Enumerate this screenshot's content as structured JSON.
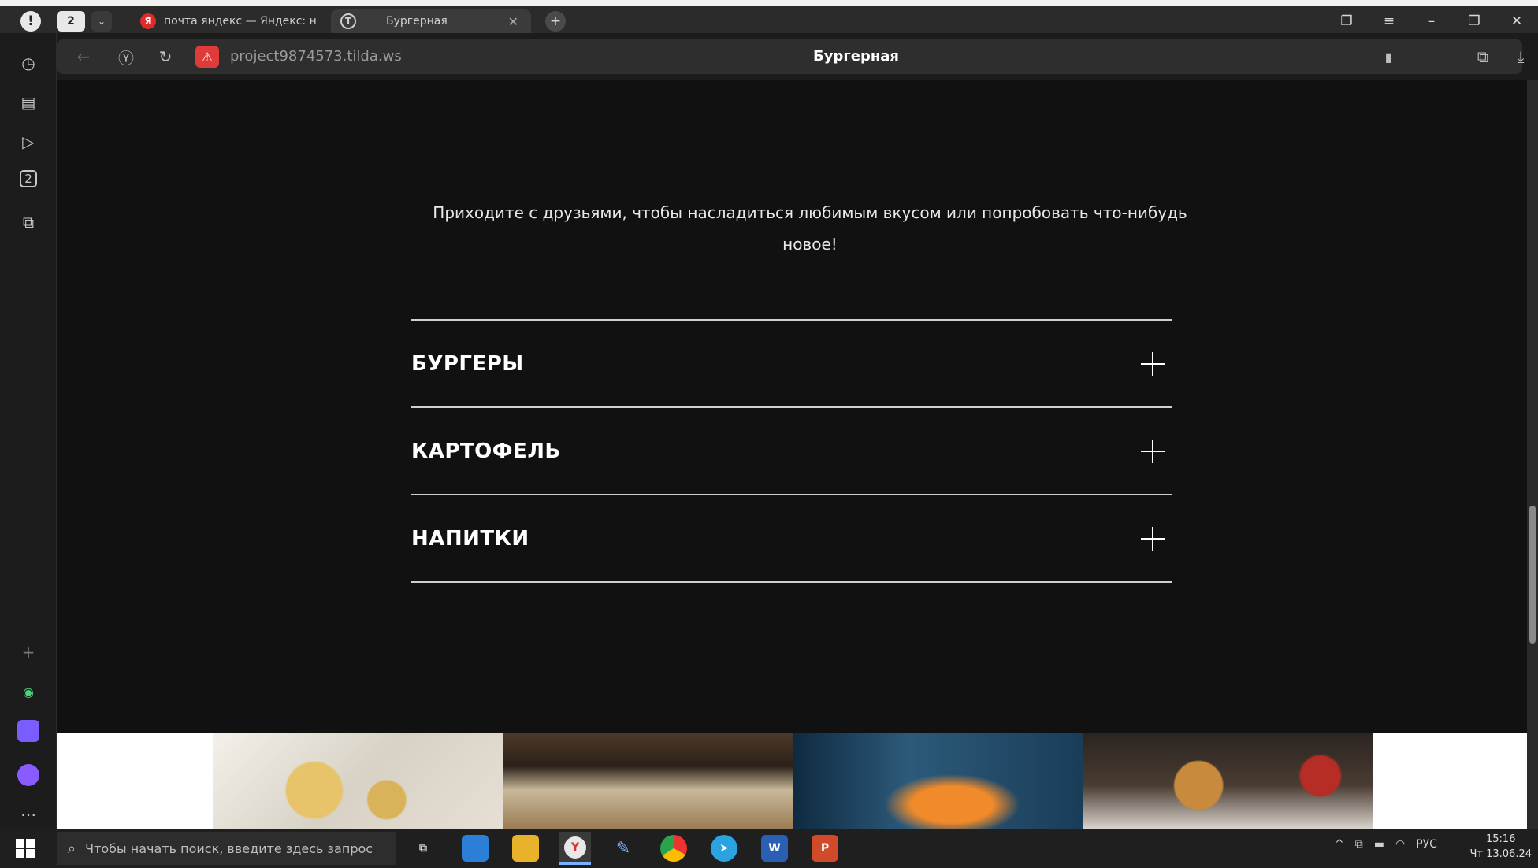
{
  "browser": {
    "tab_count": "2",
    "tabs": [
      {
        "title": "почта яндекс — Яндекс: н",
        "favicon": "yandex-icon"
      },
      {
        "title": "Бургерная",
        "favicon": "tilda-icon"
      }
    ],
    "url": "project9874573.tilda.ws",
    "page_title": "Бургерная"
  },
  "page": {
    "intro_text": "Приходите с друзьями, чтобы насладиться любимым вкусом или попробовать что-нибудь новое!",
    "accordion": [
      {
        "label": "БУРГЕРЫ"
      },
      {
        "label": "КАРТОФЕЛЬ"
      },
      {
        "label": "НАПИТКИ"
      }
    ]
  },
  "taskbar": {
    "search_placeholder": "Чтобы начать поиск, введите здесь запрос",
    "language": "РУС",
    "time": "15:16",
    "date": "Чт 13.06.24"
  },
  "colors": {
    "background": "#111111",
    "text": "#ffffff",
    "divider": "#cfcfcf"
  }
}
